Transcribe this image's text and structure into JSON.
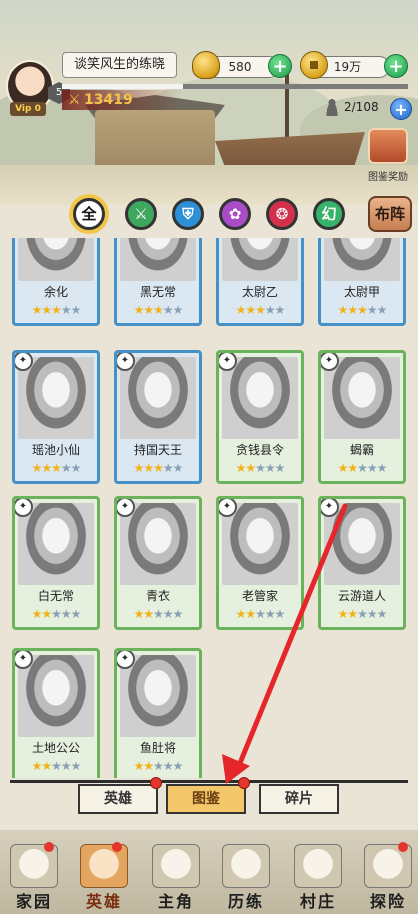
{
  "player": {
    "name": "谈笑风生的练晓",
    "vip": "Vip 0",
    "level": "5",
    "power": "13419"
  },
  "resources": {
    "ingot": "580",
    "coins": "19万"
  },
  "collection": {
    "count": "2/108",
    "album_reward": "图鉴奖励"
  },
  "filters": [
    "全",
    "⚔",
    "⛨",
    "✿",
    "❂",
    "幻"
  ],
  "formation_label": "布阵",
  "heroes": [
    {
      "name": "余化",
      "stars": 3,
      "rarity": "blue"
    },
    {
      "name": "黑无常",
      "stars": 3,
      "rarity": "blue"
    },
    {
      "name": "太尉乙",
      "stars": 3,
      "rarity": "blue"
    },
    {
      "name": "太尉甲",
      "stars": 3,
      "rarity": "blue"
    },
    {
      "name": "瑶池小仙",
      "stars": 3,
      "rarity": "blue"
    },
    {
      "name": "持国天王",
      "stars": 3,
      "rarity": "blue"
    },
    {
      "name": "贪钱县令",
      "stars": 2,
      "rarity": "green"
    },
    {
      "name": "蝎霸",
      "stars": 2,
      "rarity": "green"
    },
    {
      "name": "白无常",
      "stars": 2,
      "rarity": "green"
    },
    {
      "name": "青衣",
      "stars": 2,
      "rarity": "green"
    },
    {
      "name": "老管家",
      "stars": 2,
      "rarity": "green"
    },
    {
      "name": "云游道人",
      "stars": 2,
      "rarity": "green"
    },
    {
      "name": "土地公公",
      "stars": 2,
      "rarity": "green"
    },
    {
      "name": "鱼肚将",
      "stars": 2,
      "rarity": "green"
    }
  ],
  "tabs": {
    "heroes": "英雄",
    "album": "图鉴",
    "shards": "碎片"
  },
  "nav": [
    {
      "label": "家园",
      "icon": "home-icon"
    },
    {
      "label": "英雄",
      "icon": "hero-icon"
    },
    {
      "label": "主角",
      "icon": "protagonist-icon"
    },
    {
      "label": "历练",
      "icon": "training-icon"
    },
    {
      "label": "村庄",
      "icon": "village-icon"
    },
    {
      "label": "探险",
      "icon": "adventure-icon"
    }
  ],
  "colors": {
    "accent_gold": "#f2c649",
    "arrow_red": "#e5262b",
    "card_blue": "#4590c6",
    "card_green": "#6bb35a"
  }
}
